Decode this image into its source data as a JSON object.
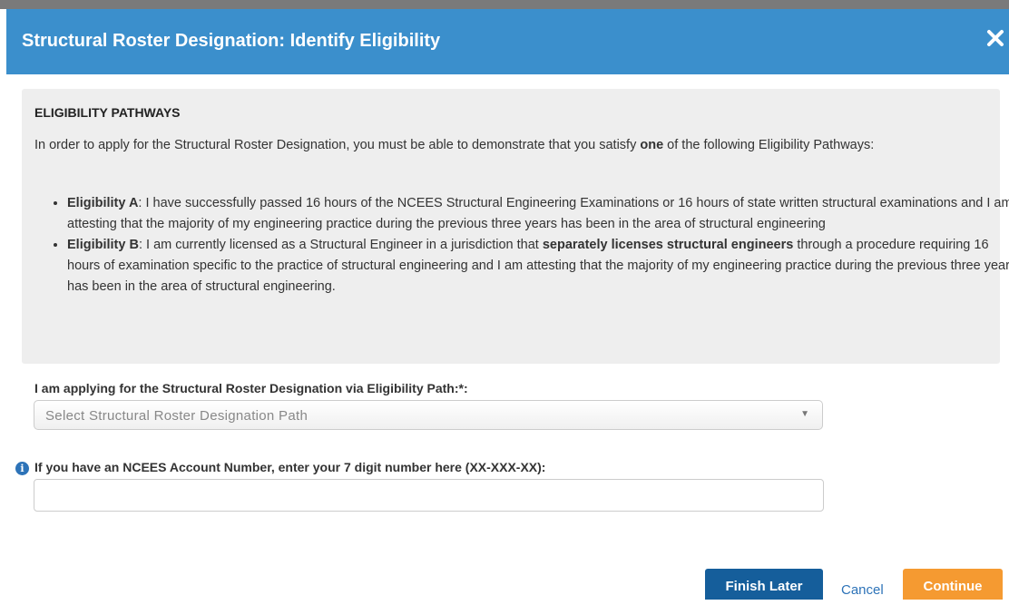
{
  "dialog": {
    "title": "Structural Roster Designation: Identify Eligibility",
    "close_icon": "close-icon"
  },
  "eligibility": {
    "heading": "ELIGIBILITY PATHWAYS",
    "intro_before": "In order to apply for the Structural Roster Designation, you must be able to demonstrate that you satisfy ",
    "intro_bold": "one",
    "intro_after": " of the following Eligibility Pathways:",
    "pathways": [
      {
        "name": "Eligibility A",
        "text_before": ": I have successfully passed 16 hours of the NCEES Structural Engineering Examinations or 16 hours of state written structural examinations and I am attesting that the majority of my engineering practice during the previous three years has been in the area of structural engineering",
        "text_bold": "",
        "text_after": ""
      },
      {
        "name": "Eligibility B",
        "text_before": ": I am currently licensed as a Structural Engineer in a jurisdiction that ",
        "text_bold": "separately licenses structural engineers",
        "text_after": " through a procedure requiring 16 hours of examination specific to the practice of structural engineering and I am attesting that the majority of my engineering practice during the previous three years has been in the area of structural engineering."
      }
    ]
  },
  "form": {
    "path_label": "I am applying for the Structural Roster Designation via Eligibility Path:*:",
    "path_select": {
      "selected": "Select Structural Roster Designation Path",
      "arrow": "▼"
    },
    "account_label": "If you have an NCEES Account Number, enter your 7 digit number here (XX-XXX-XX):",
    "account_value": "",
    "info_icon": "info-icon"
  },
  "actions": {
    "finish_later": "Finish Later",
    "cancel": "Cancel",
    "continue": "Continue"
  },
  "colors": {
    "header": "#3b8fcc",
    "panel": "#eeeeee",
    "finish_button": "#155e9b",
    "continue_button": "#f59a31",
    "link": "#2d73b8"
  }
}
